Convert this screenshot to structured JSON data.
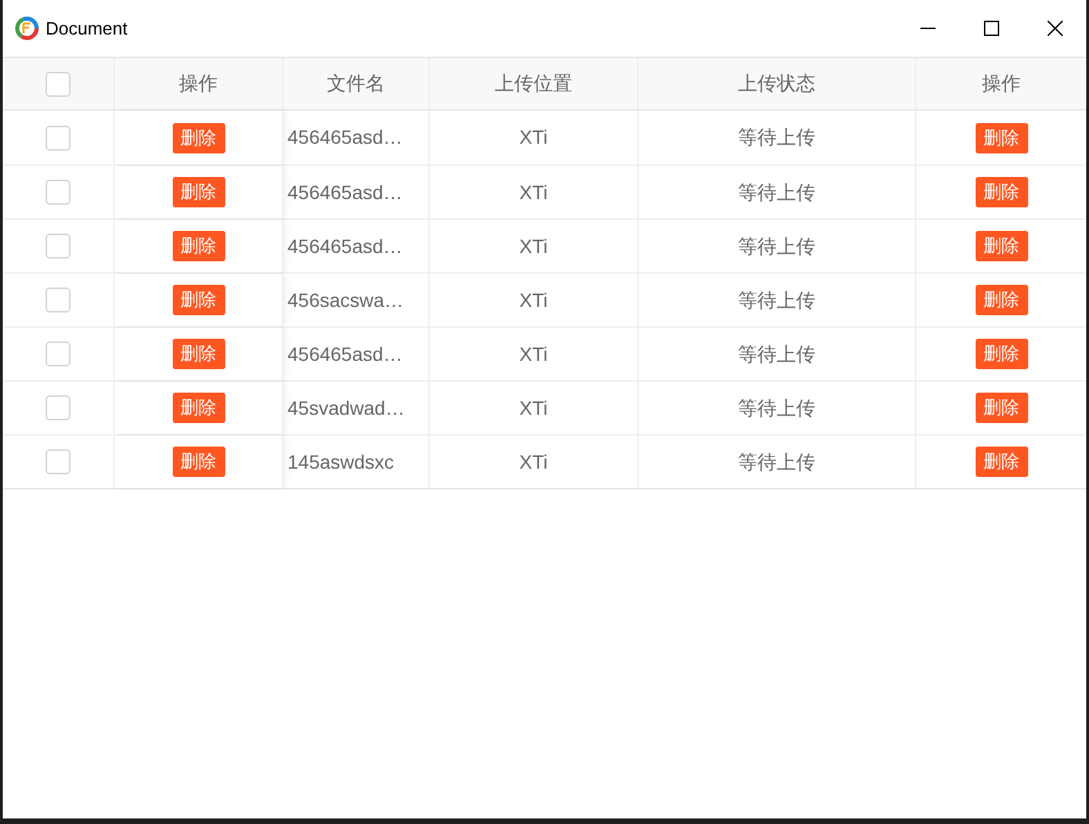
{
  "window": {
    "title": "Document"
  },
  "table": {
    "select_all": {
      "checked": false
    },
    "columns": [
      "操作",
      "文件名",
      "上传位置",
      "上传状态",
      "操作"
    ],
    "rows": [
      {
        "checked": false,
        "action_left": "删除",
        "filename": "456465asd…",
        "location": "XTi",
        "status": "等待上传",
        "action_right": "删除"
      },
      {
        "checked": false,
        "action_left": "删除",
        "filename": "456465asd…",
        "location": "XTi",
        "status": "等待上传",
        "action_right": "删除"
      },
      {
        "checked": false,
        "action_left": "删除",
        "filename": "456465asd…",
        "location": "XTi",
        "status": "等待上传",
        "action_right": "删除"
      },
      {
        "checked": false,
        "action_left": "删除",
        "filename": "456sacswa…",
        "location": "XTi",
        "status": "等待上传",
        "action_right": "删除"
      },
      {
        "checked": false,
        "action_left": "删除",
        "filename": "456465asd…",
        "location": "XTi",
        "status": "等待上传",
        "action_right": "删除"
      },
      {
        "checked": false,
        "action_left": "删除",
        "filename": "45svadwad…",
        "location": "XTi",
        "status": "等待上传",
        "action_right": "删除"
      },
      {
        "checked": false,
        "action_left": "删除",
        "filename": "145aswdsxc",
        "location": "XTi",
        "status": "等待上传",
        "action_right": "删除"
      }
    ]
  }
}
